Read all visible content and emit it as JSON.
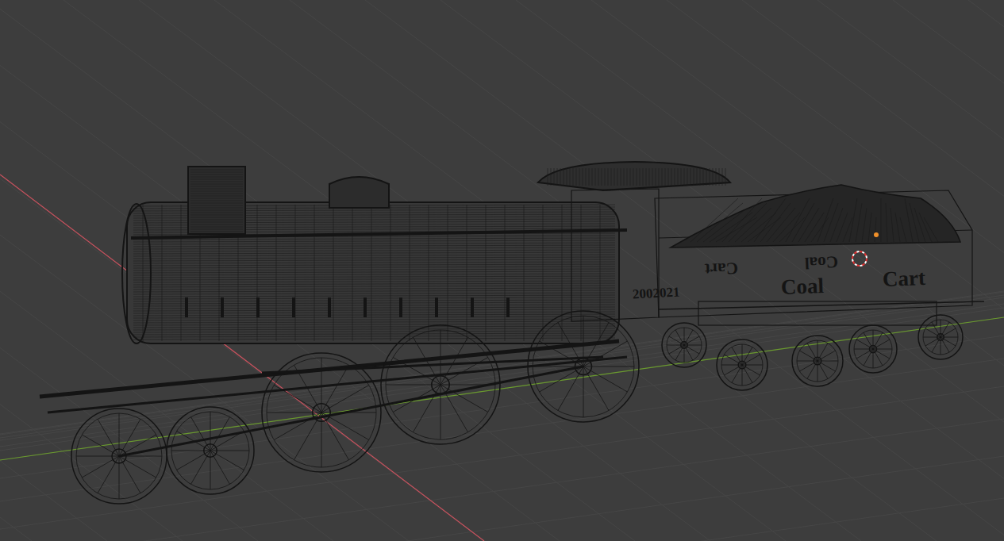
{
  "viewport": {
    "labels": [
      {
        "text": "2002021",
        "kind": "normal"
      },
      {
        "text": "Coal",
        "kind": "normal"
      },
      {
        "text": "Cart",
        "kind": "normal"
      },
      {
        "text": "Coal",
        "kind": "mirrored"
      },
      {
        "text": "Cart",
        "kind": "mirrored"
      }
    ]
  }
}
